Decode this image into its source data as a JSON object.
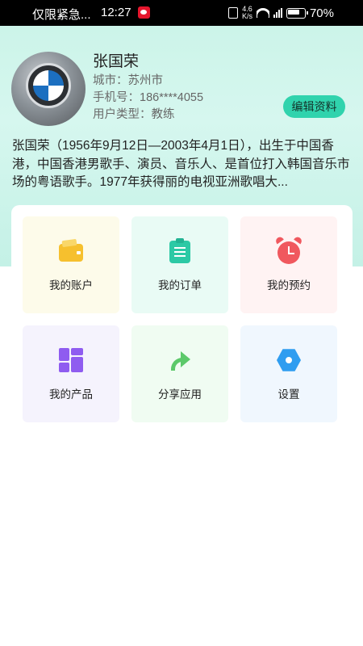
{
  "status_bar": {
    "carrier": "仅限紧急...",
    "time": "12:27",
    "network_speed_value": "4.6",
    "network_speed_unit": "K/s",
    "battery": "70%"
  },
  "profile": {
    "name": "张国荣",
    "city_label": "城市：",
    "city": "苏州市",
    "phone_label": "手机号：",
    "phone": "186****4055",
    "type_label": "用户类型：",
    "type": "教练",
    "edit_button": "编辑资料",
    "bio": "张国荣（1956年9月12日—2003年4月1日），出生于中国香港，中国香港男歌手、演员、音乐人、是首位打入韩国音乐市场的粤语歌手。1977年获得丽的电视亚洲歌唱大..."
  },
  "menu": {
    "items": [
      {
        "label": "我的账户",
        "icon": "wallet-icon",
        "bg": "#fdfbea"
      },
      {
        "label": "我的订单",
        "icon": "clipboard-icon",
        "bg": "#e9fbf5"
      },
      {
        "label": "我的预约",
        "icon": "alarm-clock-icon",
        "bg": "#fff3f3"
      },
      {
        "label": "我的产品",
        "icon": "grid-icon",
        "bg": "#f5f3fd"
      },
      {
        "label": "分享应用",
        "icon": "share-icon",
        "bg": "#f0fcf2"
      },
      {
        "label": "设置",
        "icon": "settings-hexagon-icon",
        "bg": "#f0f7fe"
      }
    ]
  },
  "colors": {
    "accent": "#30d3ad",
    "header_gradient_top": "#c9f3e7"
  }
}
